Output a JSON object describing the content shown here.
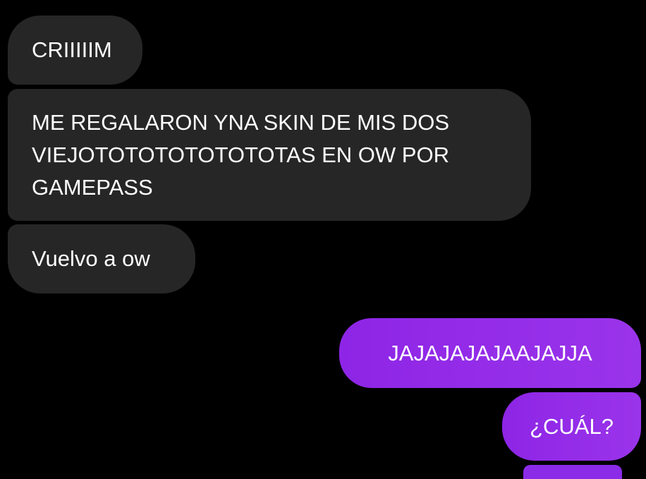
{
  "messages": [
    {
      "direction": "incoming",
      "text": "CRIIIIIM"
    },
    {
      "direction": "incoming",
      "text": "ME REGALARON YNA SKIN DE MIS DOS VIEJOTOTOTOTOTOTOTAS EN OW POR GAMEPASS"
    },
    {
      "direction": "incoming",
      "text": "Vuelvo a ow"
    },
    {
      "direction": "outgoing",
      "text": "JAJAJAJAJAAJAJJA"
    },
    {
      "direction": "outgoing",
      "text": "¿CUÁL?"
    }
  ],
  "colors": {
    "background": "#000000",
    "incoming_bubble": "#262626",
    "outgoing_bubble": "#8b2be8",
    "text": "#ffffff"
  }
}
